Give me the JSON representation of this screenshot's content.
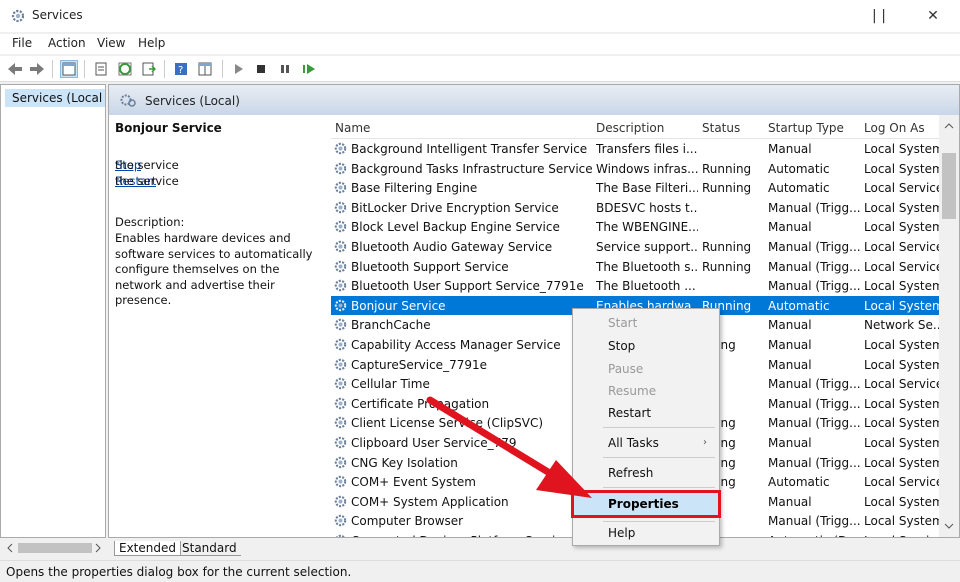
{
  "window": {
    "title": "Services",
    "minimize": "—",
    "maximize": "☐",
    "close": "✕"
  },
  "menu": [
    "File",
    "Action",
    "View",
    "Help"
  ],
  "tree": {
    "root_label": "Services (Local"
  },
  "panel": {
    "header": "Services (Local)"
  },
  "description_pane": {
    "service_name": "Bonjour Service",
    "stop_link": "Stop",
    "stop_suffix": " the service",
    "restart_link": "Restart",
    "restart_suffix": " the service",
    "label": "Description:",
    "text": "Enables hardware devices and software services to automatically configure themselves on the network and advertise their presence."
  },
  "columns": [
    "Name",
    "Description",
    "Status",
    "Startup Type",
    "Log On As"
  ],
  "rows": [
    [
      "Background Intelligent Transfer Service",
      "Transfers files i...",
      "",
      "Manual",
      "Local System"
    ],
    [
      "Background Tasks Infrastructure Service",
      "Windows infras...",
      "Running",
      "Automatic",
      "Local System"
    ],
    [
      "Base Filtering Engine",
      "The Base Filteri...",
      "Running",
      "Automatic",
      "Local Service"
    ],
    [
      "BitLocker Drive Encryption Service",
      "BDESVC hosts t...",
      "",
      "Manual (Trigg...",
      "Local System"
    ],
    [
      "Block Level Backup Engine Service",
      "The WBENGINE...",
      "",
      "Manual",
      "Local System"
    ],
    [
      "Bluetooth Audio Gateway Service",
      "Service support...",
      "Running",
      "Manual (Trigg...",
      "Local Service"
    ],
    [
      "Bluetooth Support Service",
      "The Bluetooth s...",
      "Running",
      "Manual (Trigg...",
      "Local Service"
    ],
    [
      "Bluetooth User Support Service_7791e",
      "The Bluetooth ...",
      "",
      "Manual (Trigg...",
      "Local System"
    ],
    [
      "Bonjour Service",
      "Enables hardwa...",
      "Running",
      "Automatic",
      "Local System"
    ],
    [
      "BranchCache",
      "",
      "",
      "Manual",
      "Network Se..."
    ],
    [
      "Capability Access Manager Service",
      "",
      "nning",
      "Manual",
      "Local System"
    ],
    [
      "CaptureService_7791e",
      "",
      "",
      "Manual",
      "Local System"
    ],
    [
      "Cellular Time",
      "",
      "",
      "Manual (Trigg...",
      "Local Service"
    ],
    [
      "Certificate Propagation",
      "",
      "",
      "Manual (Trigg...",
      "Local System"
    ],
    [
      "Client License Service (ClipSVC)",
      "",
      "nning",
      "Manual (Trigg...",
      "Local System"
    ],
    [
      "Clipboard User Service_779",
      "",
      "nning",
      "Manual",
      "Local System"
    ],
    [
      "CNG Key Isolation",
      "",
      "nning",
      "Manual (Trigg...",
      "Local System"
    ],
    [
      "COM+ Event System",
      "",
      "nning",
      "Automatic",
      "Local Service"
    ],
    [
      "COM+ System Application",
      "",
      "",
      "Manual",
      "Local System"
    ],
    [
      "Computer Browser",
      "",
      "",
      "Manual (Trigg...",
      "Local System"
    ],
    [
      "Connected Devices Platform Service",
      "",
      "",
      "Automatic (D...",
      "Local Service"
    ]
  ],
  "selected_row": 8,
  "context_menu": {
    "start": "Start",
    "stop": "Stop",
    "pause": "Pause",
    "resume": "Resume",
    "restart": "Restart",
    "all_tasks": "All Tasks",
    "refresh": "Refresh",
    "properties": "Properties",
    "help": "Help"
  },
  "tabs": {
    "extended": "Extended",
    "standard": "Standard"
  },
  "status": "Opens the properties dialog box for the current selection.",
  "colors": {
    "selection": "#0078d7",
    "highlight_border": "#e0141e",
    "arrow": "#e0141e"
  }
}
